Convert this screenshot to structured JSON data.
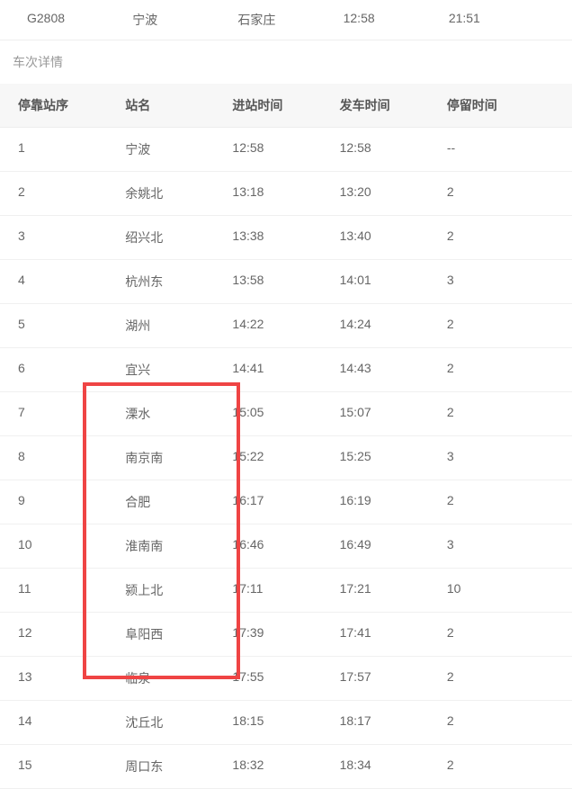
{
  "summary": {
    "trainNo": "G2808",
    "origin": "宁波",
    "destination": "石家庄",
    "departTime": "12:58",
    "arriveTime": "21:51"
  },
  "sectionTitle": "车次详情",
  "headers": {
    "stopOrder": "停靠站序",
    "stationName": "站名",
    "arrivalTime": "进站时间",
    "departureTime": "发车时间",
    "dwellTime": "停留时间"
  },
  "stops": [
    {
      "order": "1",
      "name": "宁波",
      "arrive": "12:58",
      "depart": "12:58",
      "dwell": "--"
    },
    {
      "order": "2",
      "name": "余姚北",
      "arrive": "13:18",
      "depart": "13:20",
      "dwell": "2"
    },
    {
      "order": "3",
      "name": "绍兴北",
      "arrive": "13:38",
      "depart": "13:40",
      "dwell": "2"
    },
    {
      "order": "4",
      "name": "杭州东",
      "arrive": "13:58",
      "depart": "14:01",
      "dwell": "3"
    },
    {
      "order": "5",
      "name": "湖州",
      "arrive": "14:22",
      "depart": "14:24",
      "dwell": "2"
    },
    {
      "order": "6",
      "name": "宜兴",
      "arrive": "14:41",
      "depart": "14:43",
      "dwell": "2"
    },
    {
      "order": "7",
      "name": "溧水",
      "arrive": "15:05",
      "depart": "15:07",
      "dwell": "2"
    },
    {
      "order": "8",
      "name": "南京南",
      "arrive": "15:22",
      "depart": "15:25",
      "dwell": "3"
    },
    {
      "order": "9",
      "name": "合肥",
      "arrive": "16:17",
      "depart": "16:19",
      "dwell": "2"
    },
    {
      "order": "10",
      "name": "淮南南",
      "arrive": "16:46",
      "depart": "16:49",
      "dwell": "3"
    },
    {
      "order": "11",
      "name": "颍上北",
      "arrive": "17:11",
      "depart": "17:21",
      "dwell": "10"
    },
    {
      "order": "12",
      "name": "阜阳西",
      "arrive": "17:39",
      "depart": "17:41",
      "dwell": "2"
    },
    {
      "order": "13",
      "name": "临泉",
      "arrive": "17:55",
      "depart": "17:57",
      "dwell": "2"
    },
    {
      "order": "14",
      "name": "沈丘北",
      "arrive": "18:15",
      "depart": "18:17",
      "dwell": "2"
    },
    {
      "order": "15",
      "name": "周口东",
      "arrive": "18:32",
      "depart": "18:34",
      "dwell": "2"
    }
  ]
}
